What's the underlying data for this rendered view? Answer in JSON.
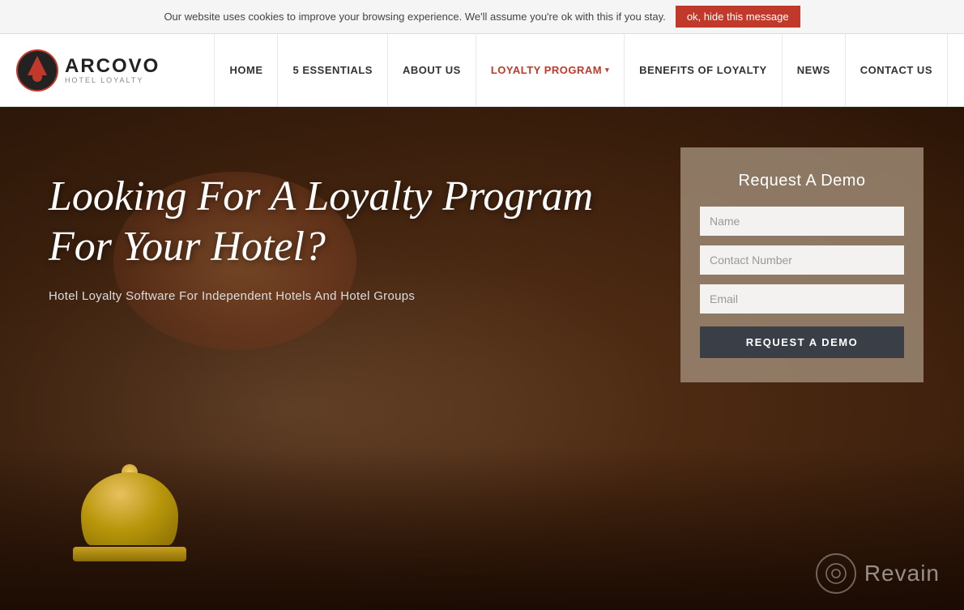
{
  "cookie": {
    "message": "Our website uses cookies to improve your browsing experience. We'll assume you're ok with this if you stay.",
    "button_label": "ok, hide this message"
  },
  "navbar": {
    "logo_name": "ARCOVO",
    "logo_subtitle": "HOTEL LOYALTY",
    "nav_items": [
      {
        "label": "HOME",
        "has_dropdown": false
      },
      {
        "label": "5 ESSENTIALS",
        "has_dropdown": false
      },
      {
        "label": "ABOUT US",
        "has_dropdown": false
      },
      {
        "label": "LOYALTY PROGRAM",
        "has_dropdown": true
      },
      {
        "label": "BENEFITS OF LOYALTY",
        "has_dropdown": false
      },
      {
        "label": "NEWS",
        "has_dropdown": false
      },
      {
        "label": "CONTACT US",
        "has_dropdown": false
      }
    ]
  },
  "hero": {
    "headline_line1": "Looking For A Loyalty Program",
    "headline_line2": "For Your Hotel?",
    "subtext": "Hotel Loyalty Software For Independent Hotels And Hotel Groups"
  },
  "demo_form": {
    "title": "Request A Demo",
    "name_placeholder": "Name",
    "contact_placeholder": "Contact Number",
    "email_placeholder": "Email",
    "button_label": "REQUEST A DEMO"
  },
  "watermark": {
    "brand": "Revain"
  }
}
